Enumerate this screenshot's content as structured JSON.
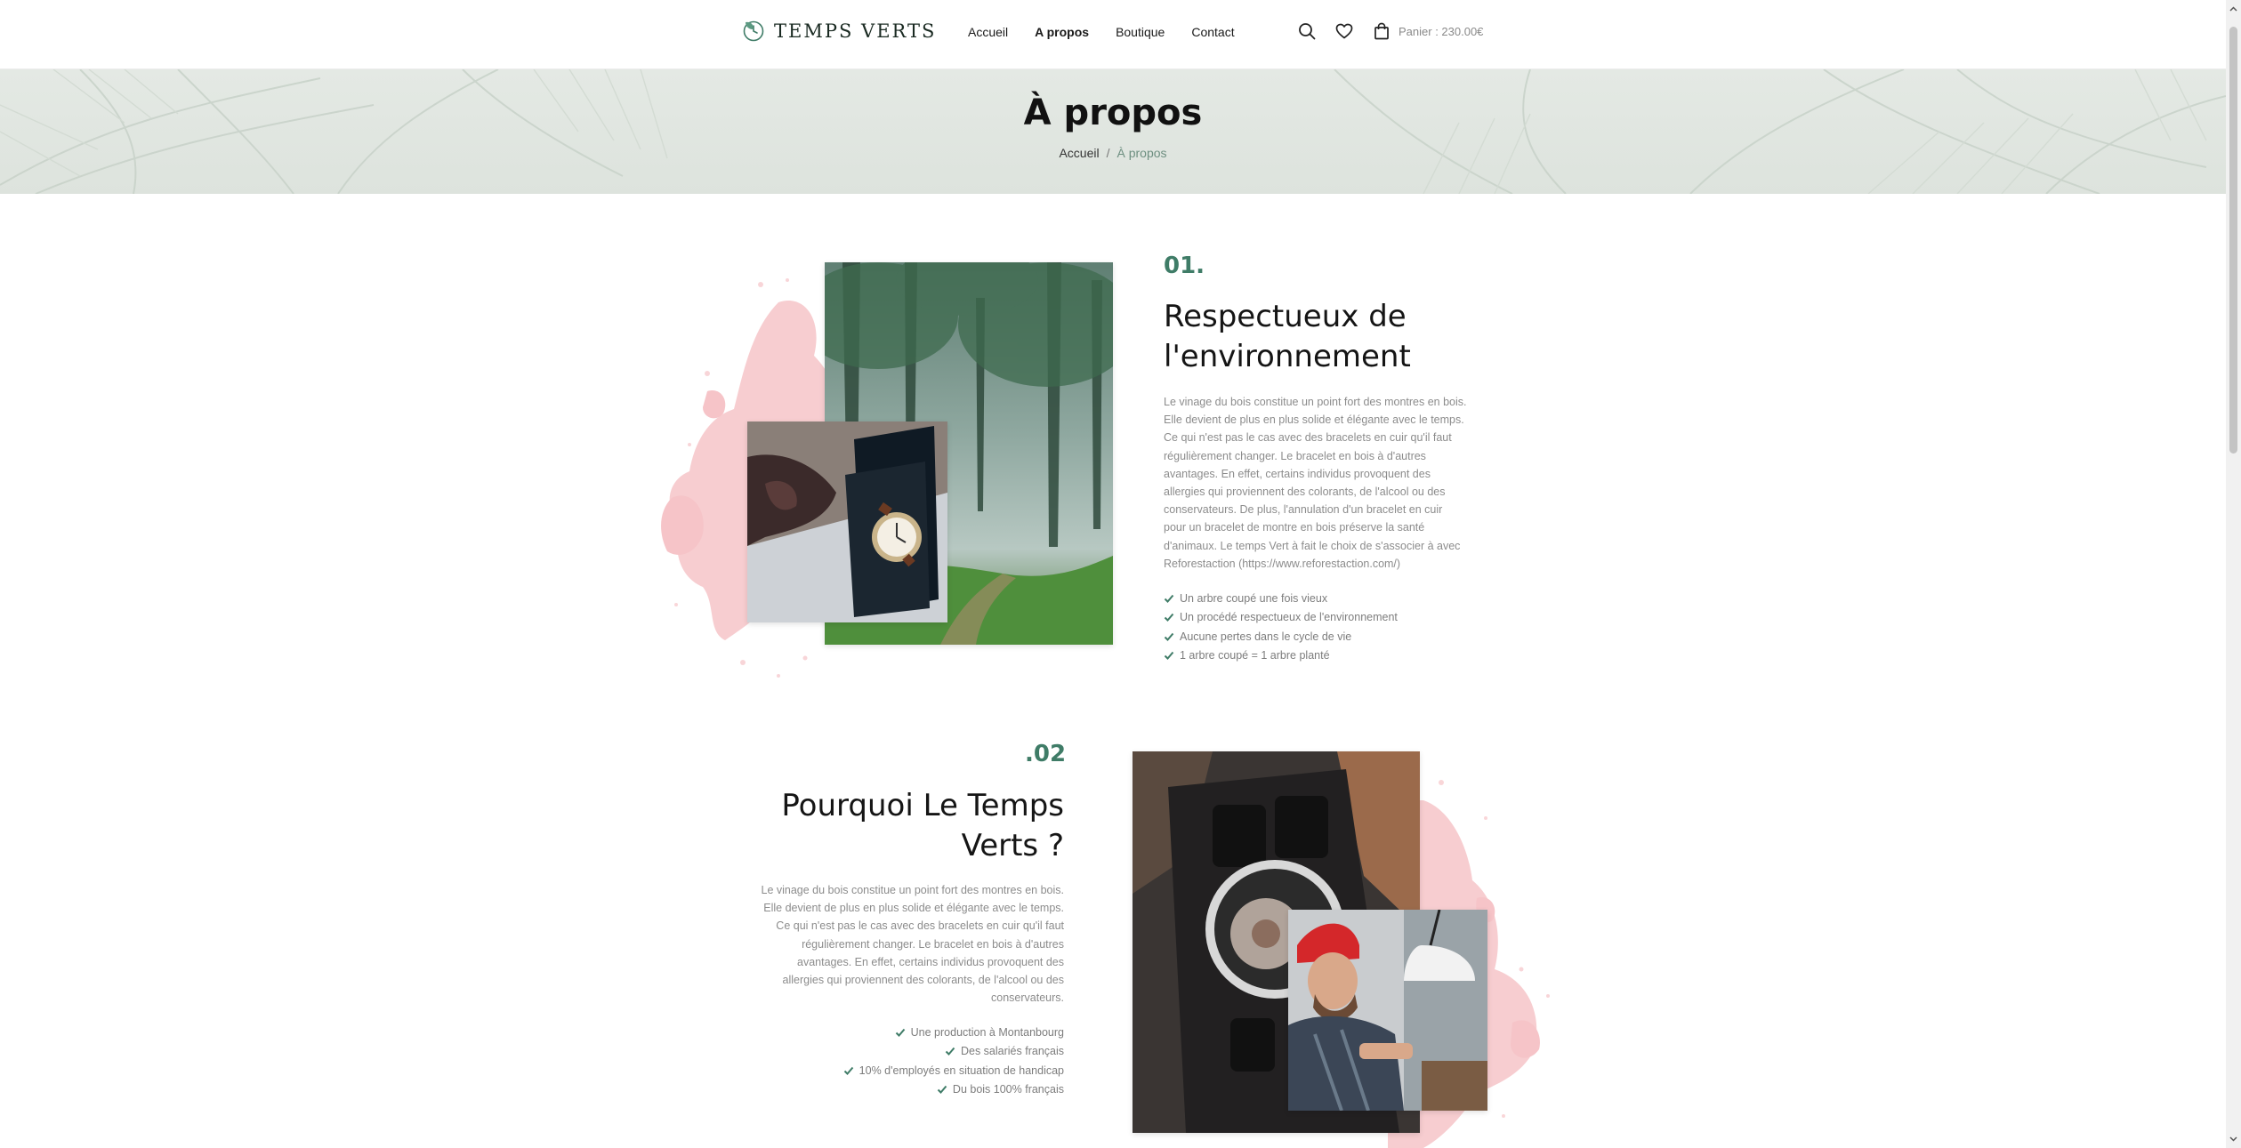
{
  "brand": {
    "name": "TEMPS VERTS"
  },
  "nav": [
    {
      "label": "Accueil",
      "active": false
    },
    {
      "label": "A propos",
      "active": true
    },
    {
      "label": "Boutique",
      "active": false
    },
    {
      "label": "Contact",
      "active": false
    }
  ],
  "header_tools": {
    "search_icon": "search-icon",
    "wishlist_icon": "heart-icon",
    "cart_icon": "shopping-bag-icon",
    "cart_label": "Panier : 230.00€"
  },
  "hero": {
    "title": "À propos",
    "breadcrumb": [
      {
        "label": "Accueil"
      },
      {
        "label": "À propos"
      }
    ],
    "breadcrumb_separator": "/"
  },
  "sections": [
    {
      "number": "01.",
      "title_lines": [
        "Respectueux de",
        "l'environnement"
      ],
      "text_lines": [
        "Le vinage du bois constitue un point fort des montres en bois.",
        "Elle devient de plus en plus solide et élégante avec le temps.",
        "Ce qui n'est pas le cas avec des bracelets en cuir qu'il faut",
        "régulièrement changer. Le bracelet en bois à d'autres",
        "avantages. En effet, certains individus provoquent des",
        "allergies qui proviennent des colorants, de l'alcool ou des",
        "conservateurs. De plus, l'annulation d'un bracelet en cuir",
        "pour un bracelet de montre en bois préserve la santé",
        "d'animaux. Le temps Vert à fait le choix de s'associer à avec",
        "Reforestaction (https://www.reforestaction.com/)"
      ],
      "bullets": [
        "Un arbre coupé une fois vieux",
        "Un procédé respectueux de l'environnement",
        "Aucune pertes dans le cycle de vie",
        "1 arbre coupé = 1 arbre planté"
      ]
    },
    {
      "number": ".02",
      "title_lines": [
        "Pourquoi Le Temps",
        "Verts ?"
      ],
      "text_lines": [
        "Le vinage du bois constitue un point fort des montres en bois.",
        "Elle devient de plus en plus solide et élégante avec le temps.",
        "Ce qui n'est pas le cas avec des bracelets en cuir qu'il faut",
        "régulièrement changer. Le bracelet en bois à d'autres",
        "avantages. En effet, certains individus provoquent des",
        "allergies qui proviennent des colorants, de l'alcool ou des",
        "conservateurs."
      ],
      "bullets": [
        "Une production à Montanbourg",
        "Des salariés français",
        "10% d'employés en situation de handicap",
        "Du bois 100% français"
      ]
    }
  ],
  "colors": {
    "accent": "#3f7c67",
    "splash": "#f6c4c8",
    "text_muted": "#8c8c8c",
    "breadcrumb_current": "#6d8f80"
  }
}
